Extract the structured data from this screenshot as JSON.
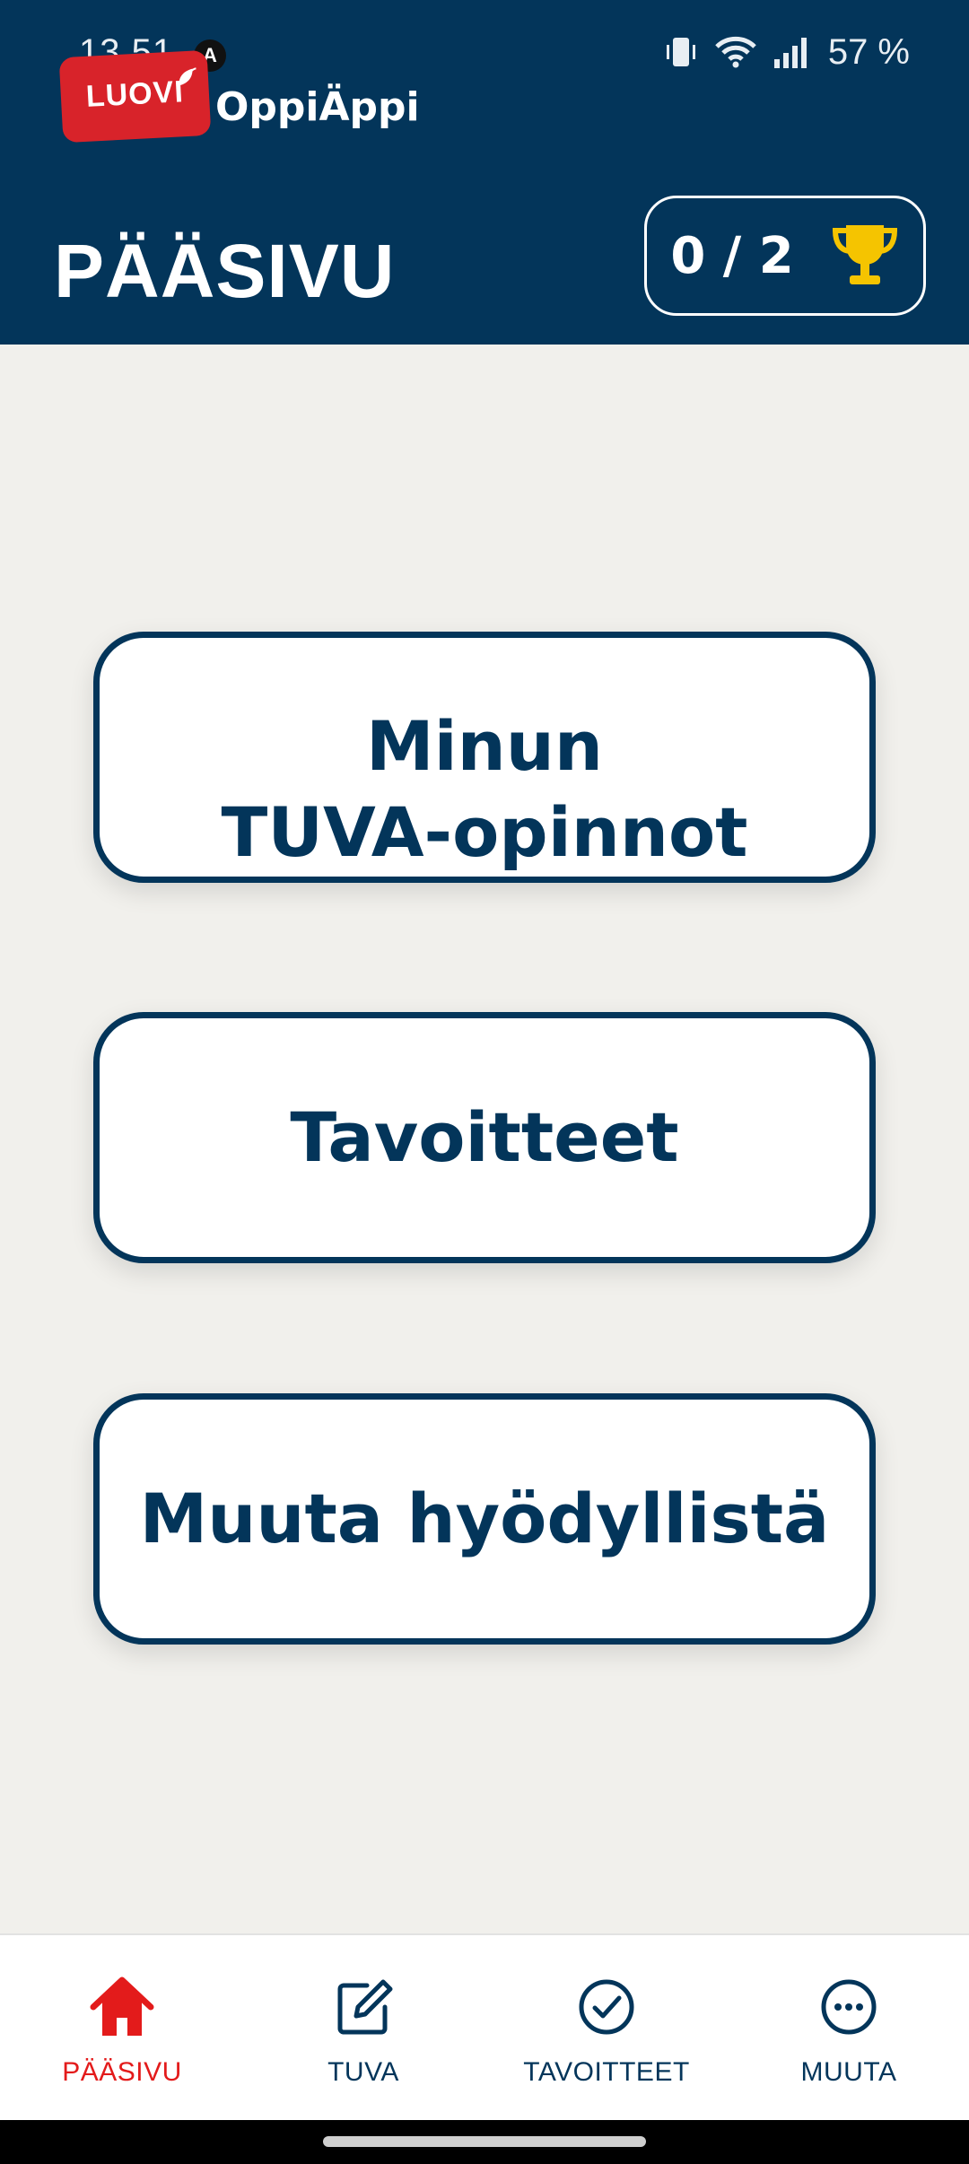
{
  "status_bar": {
    "time": "13.51",
    "notification_icon": "A",
    "battery": "57 %",
    "icons": [
      "vibrate-icon",
      "wifi-icon",
      "signal-icon"
    ]
  },
  "app": {
    "logo_text": "LUOVI",
    "name": "OppiÄppi"
  },
  "header": {
    "title": "PÄÄSIVU",
    "trophy_count": "0 / 2",
    "trophy_icon": "trophy-icon",
    "trophy_color": "#f5c400"
  },
  "menu": [
    {
      "label": "Minun\nTUVA-opinnot"
    },
    {
      "label": "Tavoitteet"
    },
    {
      "label": "Muuta hyödyllistä"
    }
  ],
  "bottom_nav": {
    "items": [
      {
        "label": "PÄÄSIVU",
        "icon": "home-icon",
        "active": true
      },
      {
        "label": "TUVA",
        "icon": "edit-icon",
        "active": false
      },
      {
        "label": "TAVOITTEET",
        "icon": "check-circle-icon",
        "active": false
      },
      {
        "label": "MUUTA",
        "icon": "more-icon",
        "active": false
      }
    ]
  },
  "colors": {
    "primary": "#03355a",
    "accent": "#e31b1b",
    "background": "#f1f0ec",
    "logo": "#d8232a"
  }
}
